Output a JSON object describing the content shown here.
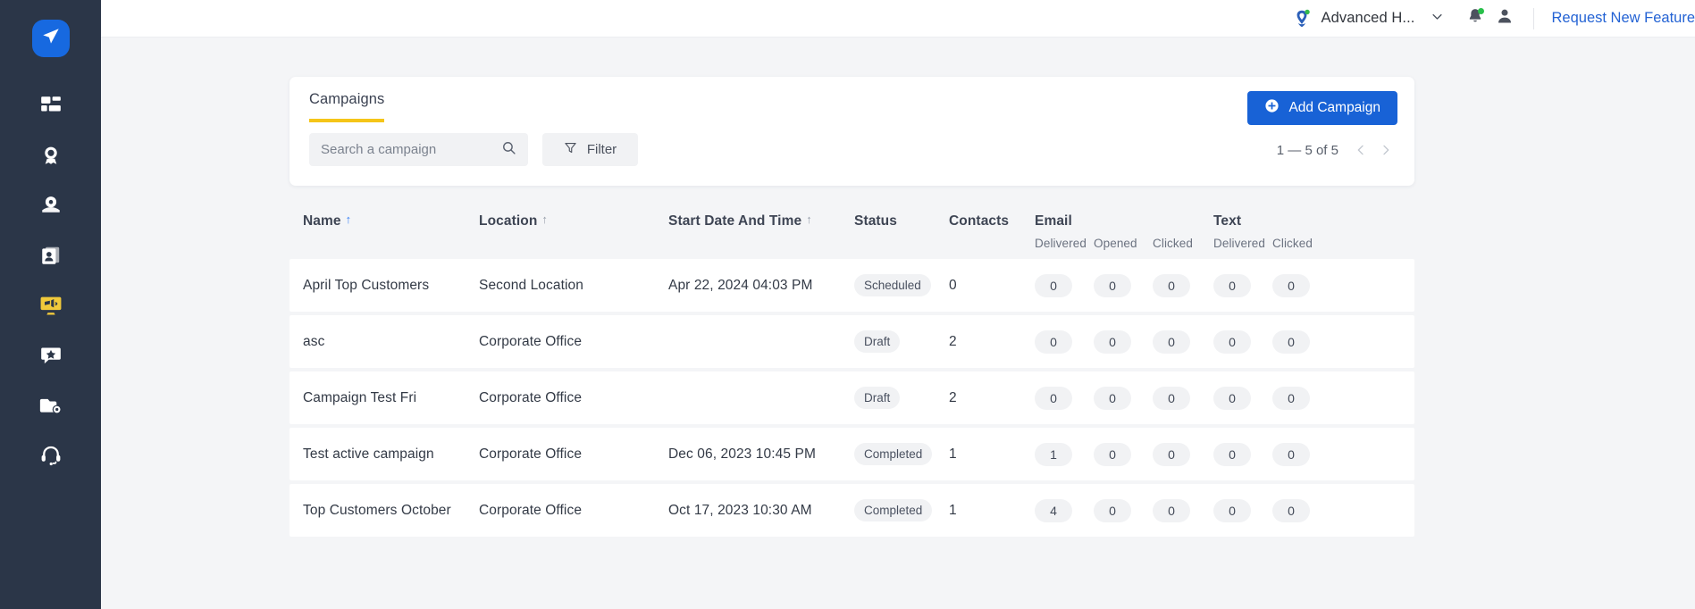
{
  "sidebar": {
    "logo_icon": "paper-plane-icon",
    "items": [
      {
        "id": "dashboard",
        "icon": "dashboard-grid-icon",
        "active": false
      },
      {
        "id": "loyalty",
        "icon": "award-badge-icon",
        "active": false
      },
      {
        "id": "locations",
        "icon": "location-globe-icon",
        "active": false
      },
      {
        "id": "contacts",
        "icon": "contact-card-icon",
        "active": false
      },
      {
        "id": "campaigns",
        "icon": "campaign-monitor-icon",
        "active": true
      },
      {
        "id": "reviews",
        "icon": "star-chat-icon",
        "active": false
      },
      {
        "id": "files",
        "icon": "folder-gear-icon",
        "active": false
      },
      {
        "id": "support",
        "icon": "headset-icon",
        "active": false
      }
    ]
  },
  "topbar": {
    "org_name": "Advanced H...",
    "org_logo_icon": "organization-logo-icon",
    "chevron_icon": "chevron-down-icon",
    "bell_icon": "bell-icon",
    "bell_has_badge": true,
    "avatar_icon": "user-avatar-icon",
    "request_feature_label": "Request New Feature",
    "link_color": "#2463d4"
  },
  "toolbar": {
    "tabs": [
      {
        "label": "Campaigns",
        "active": true
      }
    ],
    "tab_underline_color": "#f5c518",
    "search": {
      "placeholder": "Search a campaign",
      "value": "",
      "icon": "search-icon"
    },
    "filter": {
      "label": "Filter",
      "icon": "filter-funnel-icon"
    },
    "add_button": {
      "label": "Add Campaign",
      "icon": "plus-circle-icon",
      "color": "#1862d6"
    },
    "pagination": {
      "label": "1 — 5 of 5",
      "prev_icon": "chevron-left-icon",
      "next_icon": "chevron-right-icon"
    }
  },
  "table": {
    "columns": {
      "name": {
        "label": "Name",
        "sort": "asc",
        "sort_active": true
      },
      "location": {
        "label": "Location",
        "sort": "asc",
        "sort_active": false
      },
      "date": {
        "label": "Start Date And Time",
        "sort": "asc",
        "sort_active": false
      },
      "status": {
        "label": "Status"
      },
      "contacts": {
        "label": "Contacts"
      },
      "email": {
        "label": "Email",
        "sub": [
          "Delivered",
          "Opened",
          "Clicked"
        ]
      },
      "text": {
        "label": "Text",
        "sub": [
          "Delivered",
          "Clicked"
        ]
      }
    },
    "rows": [
      {
        "name": "April Top Customers",
        "location": "Second Location",
        "date": "Apr 22, 2024 04:03 PM",
        "status": "Scheduled",
        "contacts": "0",
        "email_delivered": "0",
        "email_opened": "0",
        "email_clicked": "0",
        "text_delivered": "0",
        "text_clicked": "0"
      },
      {
        "name": "asc",
        "location": "Corporate Office",
        "date": "",
        "status": "Draft",
        "contacts": "2",
        "email_delivered": "0",
        "email_opened": "0",
        "email_clicked": "0",
        "text_delivered": "0",
        "text_clicked": "0"
      },
      {
        "name": "Campaign Test Fri",
        "location": "Corporate Office",
        "date": "",
        "status": "Draft",
        "contacts": "2",
        "email_delivered": "0",
        "email_opened": "0",
        "email_clicked": "0",
        "text_delivered": "0",
        "text_clicked": "0"
      },
      {
        "name": "Test active campaign",
        "location": "Corporate Office",
        "date": "Dec 06, 2023 10:45 PM",
        "status": "Completed",
        "contacts": "1",
        "email_delivered": "1",
        "email_opened": "0",
        "email_clicked": "0",
        "text_delivered": "0",
        "text_clicked": "0"
      },
      {
        "name": "Top Customers October",
        "location": "Corporate Office",
        "date": "Oct 17, 2023 10:30 AM",
        "status": "Completed",
        "contacts": "1",
        "email_delivered": "4",
        "email_opened": "0",
        "email_clicked": "0",
        "text_delivered": "0",
        "text_clicked": "0"
      }
    ]
  }
}
